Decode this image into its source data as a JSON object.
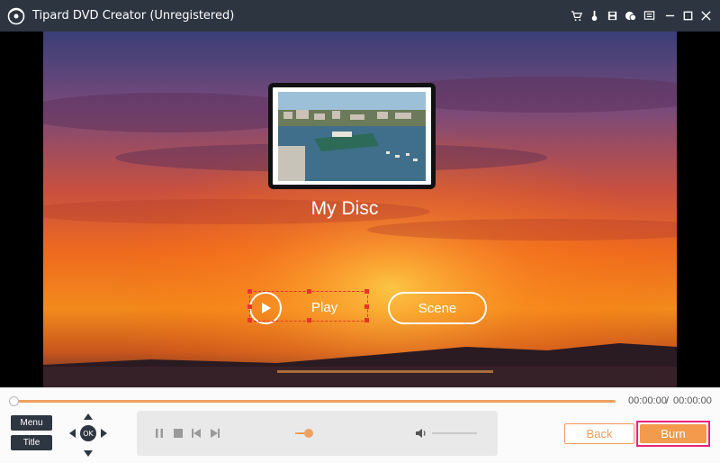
{
  "app": {
    "title": "Tipard DVD Creator (Unregistered)",
    "accent": "#f39a4c",
    "titlebar_bg": "#2d3541",
    "highlight": "#e8237a",
    "toolbar_icons": [
      "cart-icon",
      "key-icon",
      "save-icon",
      "chat-icon",
      "feedback-icon",
      "minimize-icon",
      "maximize-icon",
      "close-icon"
    ]
  },
  "preview": {
    "disc_title": "My Disc",
    "play_label": "Play",
    "scene_label": "Scene"
  },
  "player": {
    "current_time": "00:00:00",
    "separator": "/",
    "total_time": "00:00:00",
    "progress": 0,
    "volume": 0.3,
    "menu_label": "Menu",
    "title_label": "Title",
    "ok_label": "OK"
  },
  "actions": {
    "back_label": "Back",
    "burn_label": "Burn"
  }
}
